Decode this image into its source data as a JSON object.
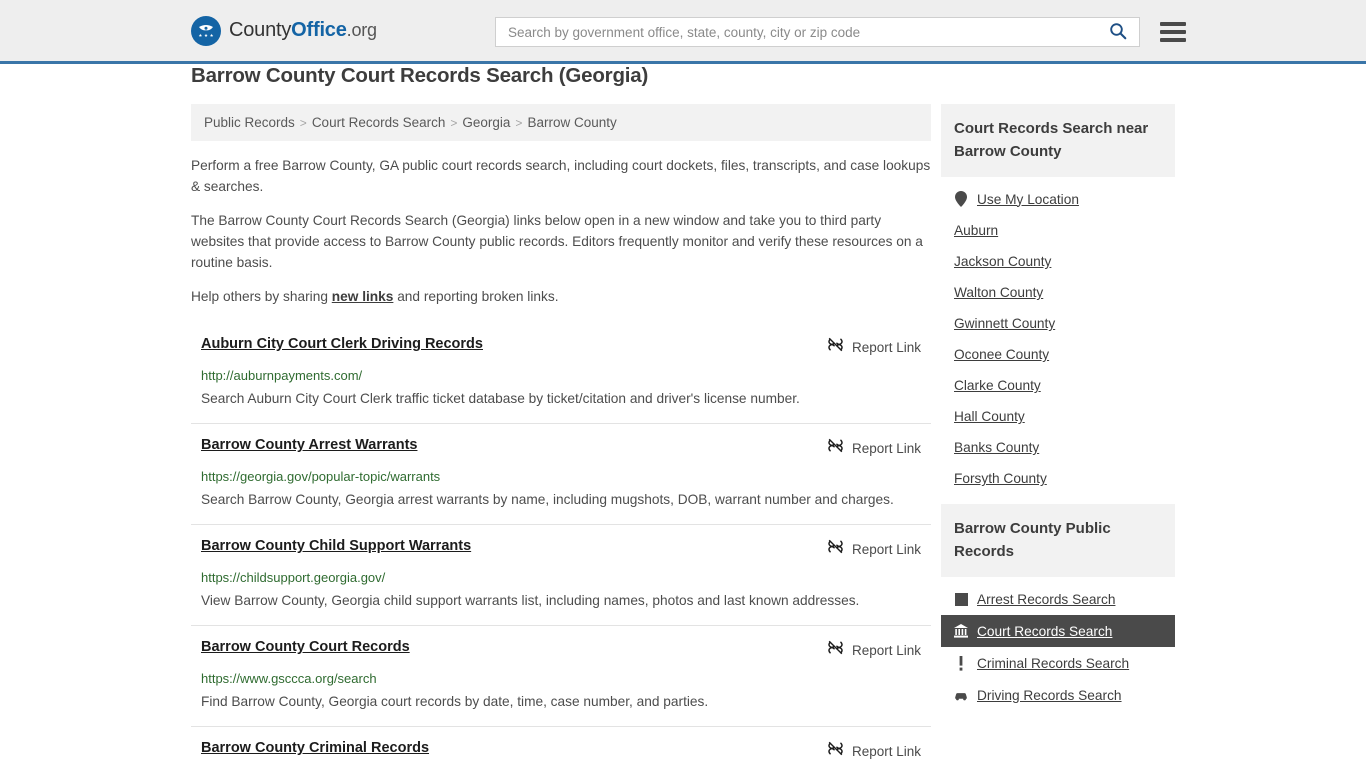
{
  "header": {
    "logo_text_1": "County",
    "logo_text_2": "Office",
    "logo_text_3": ".org",
    "search_placeholder": "Search by government office, state, county, city or zip code",
    "search_value": "",
    "search_icon": "search-icon",
    "menu_icon": "hamburger-menu-icon"
  },
  "page_title": "Barrow County Court Records Search (Georgia)",
  "breadcrumb": {
    "separator": ">",
    "items": [
      {
        "label": "Public Records"
      },
      {
        "label": "Court Records Search"
      },
      {
        "label": "Georgia"
      },
      {
        "label": "Barrow County"
      }
    ]
  },
  "intro": {
    "p1": "Perform a free Barrow County, GA public court records search, including court dockets, files, transcripts, and case lookups & searches.",
    "p2": "The Barrow County Court Records Search (Georgia) links below open in a new window and take you to third party websites that provide access to Barrow County public records. Editors frequently monitor and verify these resources on a routine basis.",
    "p3_before": "Help others by sharing ",
    "p3_link": "new links",
    "p3_after": " and reporting broken links."
  },
  "results": {
    "report_label": "Report Link",
    "report_icon": "broken-link-icon",
    "items": [
      {
        "title": "Auburn City Court Clerk Driving Records",
        "url": "http://auburnpayments.com/",
        "description": "Search Auburn City Court Clerk traffic ticket database by ticket/citation and driver's license number."
      },
      {
        "title": "Barrow County Arrest Warrants",
        "url": "https://georgia.gov/popular-topic/warrants",
        "description": "Search Barrow County, Georgia arrest warrants by name, including mugshots, DOB, warrant number and charges."
      },
      {
        "title": "Barrow County Child Support Warrants",
        "url": "https://childsupport.georgia.gov/",
        "description": "View Barrow County, Georgia child support warrants list, including names, photos and last known addresses."
      },
      {
        "title": "Barrow County Court Records",
        "url": "https://www.gsccca.org/search",
        "description": "Find Barrow County, Georgia court records by date, time, case number, and parties."
      },
      {
        "title": "Barrow County Criminal Records",
        "url": "",
        "description": ""
      }
    ]
  },
  "sidebar": {
    "nearby": {
      "heading": "Court Records Search near Barrow County",
      "items": [
        {
          "label": "Use My Location",
          "icon": "map-pin-icon"
        },
        {
          "label": "Auburn",
          "icon": ""
        },
        {
          "label": "Jackson County",
          "icon": ""
        },
        {
          "label": "Walton County",
          "icon": ""
        },
        {
          "label": "Gwinnett County",
          "icon": ""
        },
        {
          "label": "Oconee County",
          "icon": ""
        },
        {
          "label": "Clarke County",
          "icon": ""
        },
        {
          "label": "Hall County",
          "icon": ""
        },
        {
          "label": "Banks County",
          "icon": ""
        },
        {
          "label": "Forsyth County",
          "icon": ""
        }
      ]
    },
    "public_records": {
      "heading": "Barrow County Public Records",
      "items": [
        {
          "label": "Arrest Records Search",
          "icon": "handcuffs-icon",
          "active": false
        },
        {
          "label": "Court Records Search",
          "icon": "courthouse-icon",
          "active": true
        },
        {
          "label": "Criminal Records Search",
          "icon": "exclamation-icon",
          "active": false
        },
        {
          "label": "Driving Records Search",
          "icon": "car-icon",
          "active": false
        }
      ]
    }
  },
  "colors": {
    "header_bg": "#eeeeee",
    "header_border": "#3a75a8",
    "brand_blue": "#1464a5",
    "url_green": "#2f6b30",
    "panel_gray": "#f2f2f2",
    "active_dark": "#4a4a4a"
  }
}
